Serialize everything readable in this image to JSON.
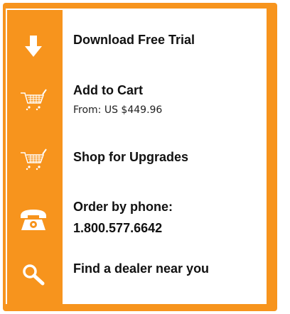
{
  "colors": {
    "accent": "#f7941d",
    "background": "#ffffff",
    "text": "#111111"
  },
  "items": [
    {
      "icon": "download-arrow-icon",
      "title": "Download Free Trial"
    },
    {
      "icon": "shopping-cart-icon",
      "title": "Add to Cart",
      "sub": "From: US $449.96"
    },
    {
      "icon": "shopping-cart-icon",
      "title": "Shop for Upgrades"
    },
    {
      "icon": "telephone-icon",
      "title": "Order by phone:",
      "title2": "1.800.577.6642"
    },
    {
      "icon": "magnifier-search-icon",
      "title": "Find a dealer near you"
    }
  ]
}
